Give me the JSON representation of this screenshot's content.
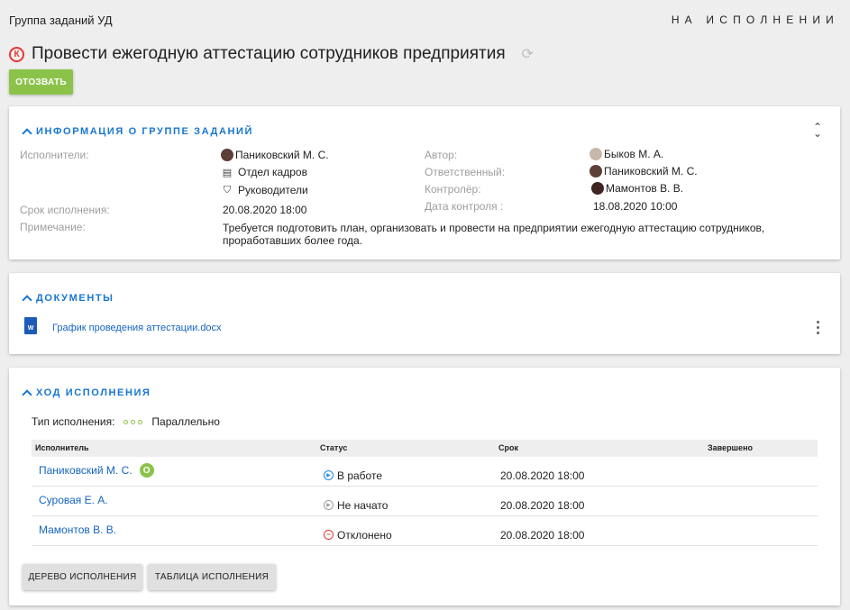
{
  "header": {
    "group_title": "Группа заданий УД",
    "status": "НА ИСПОЛНЕНИИ"
  },
  "task": {
    "badge": "К",
    "title": "Провести ежегодную аттестацию сотрудников предприятия",
    "recall_label": "ОТОЗВАТЬ"
  },
  "info": {
    "header": "ИНФОРМАЦИЯ О ГРУППЕ ЗАДАНИЙ",
    "performers_label": "Исполнители:",
    "performers": [
      {
        "name": "Паниковский М. С.",
        "icon": "avatar"
      },
      {
        "name": "Отдел кадров",
        "icon": "department-icon"
      },
      {
        "name": "Руководители",
        "icon": "group-icon"
      }
    ],
    "deadline_label": "Срок исполнения:",
    "deadline": "20.08.2020 18:00",
    "note_label": "Примечание:",
    "note": "Требуется подготовить план, организовать и провести на предприятии ежегодную аттестацию сотрудников, проработавших более года.",
    "author_label": "Автор:",
    "author": "Быков М. А.",
    "responsible_label": "Ответственный:",
    "responsible": "Паниковский М. С.",
    "controller_label": "Контролёр:",
    "controller": "Мамонтов В. В.",
    "control_date_label": "Дата контроля :",
    "control_date": "18.08.2020 10:00"
  },
  "documents": {
    "header": "ДОКУМЕНТЫ",
    "files": [
      {
        "name": "График проведения аттестации.docx",
        "icon_letter": "W"
      }
    ]
  },
  "progress": {
    "header": "ХОД ИСПОЛНЕНИЯ",
    "exec_type_label": "Тип исполнения:",
    "exec_type": "Параллельно",
    "columns": [
      "Исполнитель",
      "Статус",
      "Срок",
      "Завершено"
    ],
    "rows": [
      {
        "performer": "Паниковский М. С.",
        "badge": "О",
        "status": "В работе",
        "status_kind": "work",
        "deadline": "20.08.2020 18:00",
        "completed": ""
      },
      {
        "performer": "Суровая Е. А.",
        "badge": "",
        "status": "Не начато",
        "status_kind": "new",
        "deadline": "20.08.2020 18:00",
        "completed": ""
      },
      {
        "performer": "Мамонтов В. В.",
        "badge": "",
        "status": "Отклонено",
        "status_kind": "rejected",
        "deadline": "20.08.2020 18:00",
        "completed": ""
      }
    ],
    "tree_button": "ДЕРЕВО ИСПОЛНЕНИЯ",
    "table_button": "ТАБЛИЦА ИСПОЛНЕНИЯ"
  },
  "colors": {
    "accent_blue": "#1976d2",
    "green": "#8bc34a",
    "red": "#e53935"
  }
}
